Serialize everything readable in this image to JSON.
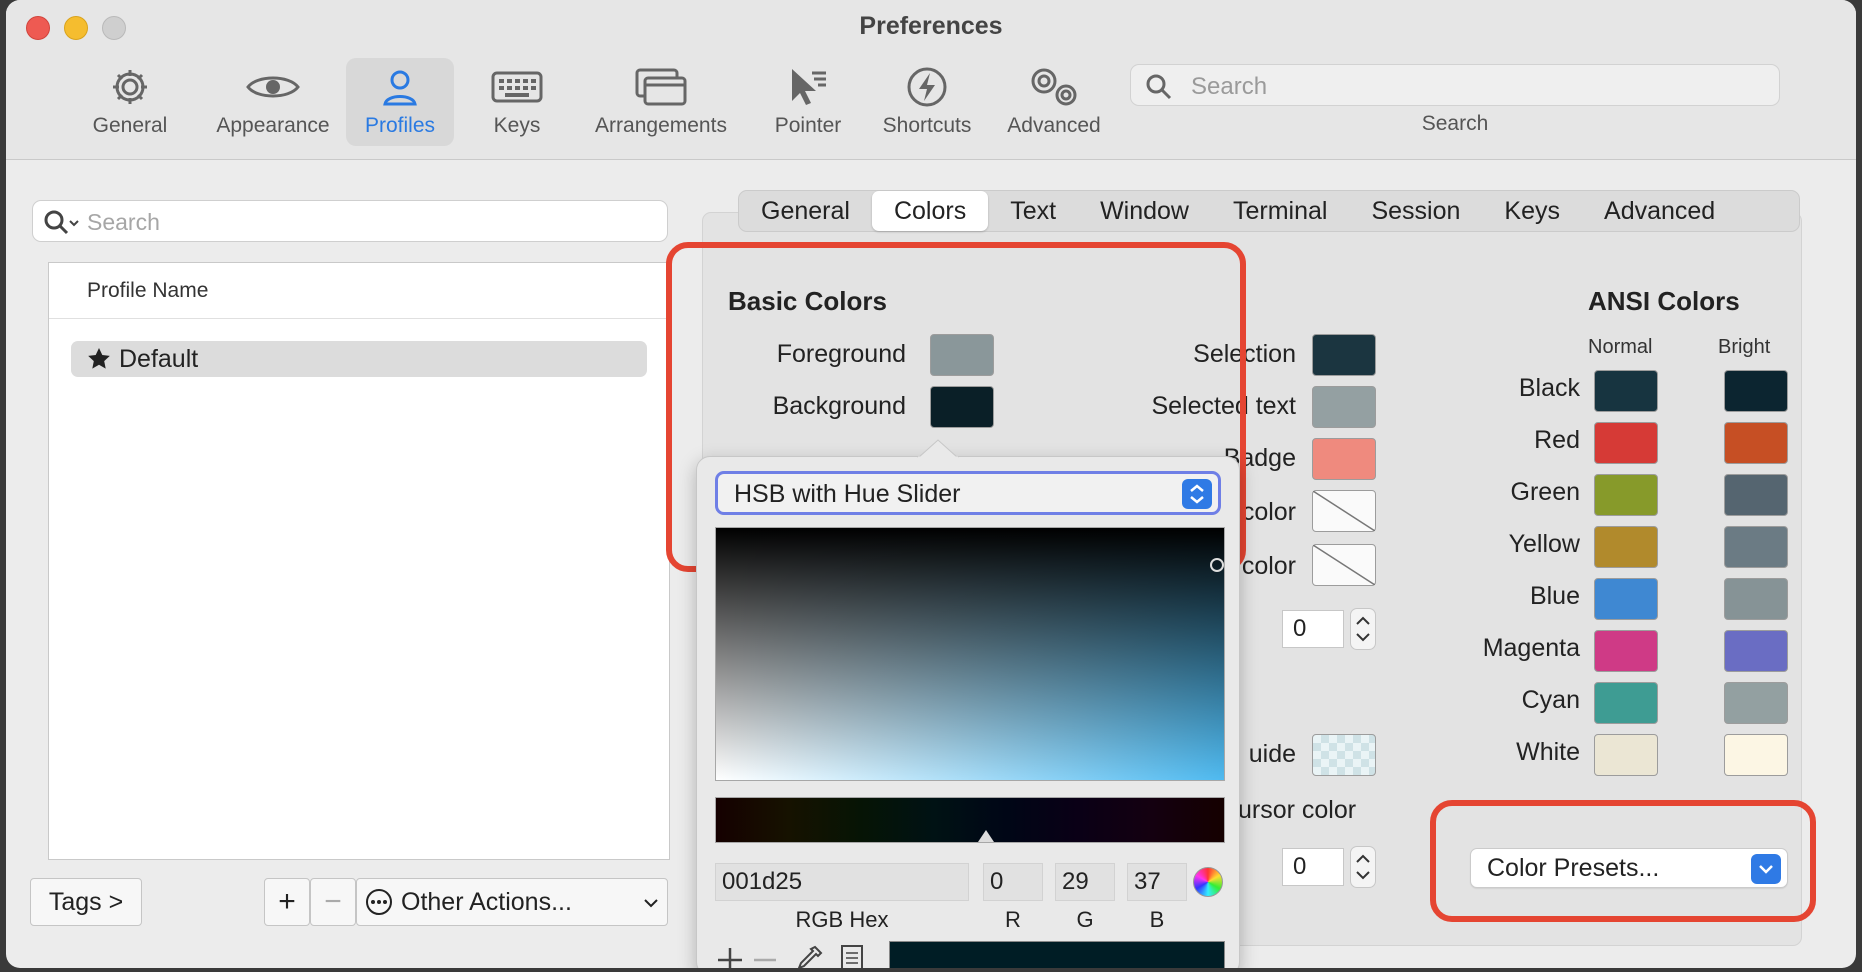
{
  "window": {
    "title": "Preferences"
  },
  "toolbar": {
    "items": [
      {
        "label": "General",
        "icon": "gear-icon"
      },
      {
        "label": "Appearance",
        "icon": "eye-icon"
      },
      {
        "label": "Profiles",
        "icon": "person-icon",
        "active": true
      },
      {
        "label": "Keys",
        "icon": "keyboard-icon"
      },
      {
        "label": "Arrangements",
        "icon": "windows-icon"
      },
      {
        "label": "Pointer",
        "icon": "pointer-icon"
      },
      {
        "label": "Shortcuts",
        "icon": "bolt-icon"
      },
      {
        "label": "Advanced",
        "icon": "gears-icon"
      }
    ],
    "search_placeholder": "Search",
    "search_label": "Search"
  },
  "profiles": {
    "search_placeholder": "Search",
    "column_header": "Profile Name",
    "items": [
      {
        "name": "Default",
        "default": true
      }
    ],
    "tags_button": "Tags >",
    "add_symbol": "+",
    "remove_symbol": "−",
    "other_actions": "Other Actions..."
  },
  "tabs": [
    "General",
    "Colors",
    "Text",
    "Window",
    "Terminal",
    "Session",
    "Keys",
    "Advanced"
  ],
  "selected_tab": "Colors",
  "basic_colors": {
    "title": "Basic Colors",
    "foreground": {
      "label": "Foreground",
      "color": "#8a979a"
    },
    "background": {
      "label": "Background",
      "color": "#0a1f27"
    },
    "selection": {
      "label": "Selection",
      "color": "#1b3540"
    },
    "selected_text": {
      "label": "Selected text",
      "color": "#94a0a2"
    },
    "badge": {
      "label": "Badge",
      "color": "#ef8a7e"
    },
    "color_a": {
      "label": "color"
    },
    "color_b": {
      "label": "color"
    },
    "guide": {
      "label": "uide"
    },
    "cursor_color": {
      "label": "ursor color"
    },
    "stepper_a": "0",
    "stepper_b": "0"
  },
  "ansi": {
    "title": "ANSI Colors",
    "normal_header": "Normal",
    "bright_header": "Bright",
    "rows": [
      {
        "name": "Black",
        "normal": "#173440",
        "bright": "#0c2530"
      },
      {
        "name": "Red",
        "normal": "#d63a36",
        "bright": "#c64f24"
      },
      {
        "name": "Green",
        "normal": "#879a2a",
        "bright": "#556570"
      },
      {
        "name": "Yellow",
        "normal": "#b18a2c",
        "bright": "#6b7b84"
      },
      {
        "name": "Blue",
        "normal": "#3f88d2",
        "bright": "#869396"
      },
      {
        "name": "Magenta",
        "normal": "#cf3a86",
        "bright": "#6a6dc3"
      },
      {
        "name": "Cyan",
        "normal": "#3e9c93",
        "bright": "#93a0a1"
      },
      {
        "name": "White",
        "normal": "#ebe6d4",
        "bright": "#fcf6e4"
      }
    ],
    "presets_label": "Color Presets..."
  },
  "color_picker": {
    "mode": "HSB with Hue Slider",
    "hex_value": "001d25",
    "hex_label": "RGB Hex",
    "r": "0",
    "g": "29",
    "b": "37",
    "r_label": "R",
    "g_label": "G",
    "b_label": "B",
    "current_color": "#001d25"
  },
  "highlight_color": "#e54532",
  "accent_color": "#2f7ae5"
}
